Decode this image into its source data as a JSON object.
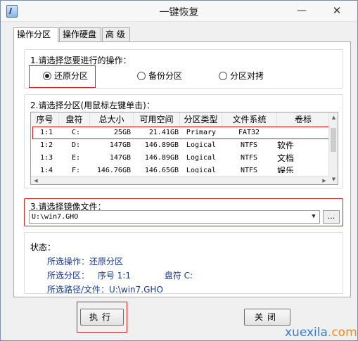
{
  "window": {
    "title": "一键恢复",
    "minimize": "—",
    "close": "✕",
    "icon": "app-icon"
  },
  "tabs": [
    {
      "label": "操作分区"
    },
    {
      "label": "操作硬盘"
    },
    {
      "label": "高 级"
    }
  ],
  "section1": {
    "title": "1.请选择您要进行的操作：",
    "options": [
      {
        "label": "还原分区",
        "selected": true
      },
      {
        "label": "备份分区",
        "selected": false
      },
      {
        "label": "分区对拷",
        "selected": false
      }
    ]
  },
  "section2": {
    "title": "2.请选择分区(用鼠标左键单击)：",
    "columns": [
      "序号",
      "盘符",
      "总大小",
      "可用空间",
      "分区类型",
      "文件系统",
      "卷标"
    ],
    "rows": [
      [
        "1:1",
        "C:",
        "25GB",
        "21.41GB",
        "Primary",
        "FAT32",
        ""
      ],
      [
        "1:2",
        "D:",
        "147GB",
        "146.89GB",
        "Logical",
        "NTFS",
        "软件"
      ],
      [
        "1:3",
        "E:",
        "147GB",
        "146.89GB",
        "Logical",
        "NTFS",
        "文档"
      ],
      [
        "1:4",
        "F:",
        "146.76GB",
        "146.65GB",
        "Logical",
        "NTFS",
        "娱乐"
      ]
    ]
  },
  "section3": {
    "title": "3.请选择镜像文件：",
    "file_value": "U:\\win7.GHO",
    "browse_label": "..."
  },
  "status": {
    "title": "状态：",
    "operation": "所选操作：还原分区",
    "partition_label": "所选分区：",
    "partition_index": "序号 1:1",
    "partition_drive": "盘符 C:",
    "path": "所选路径/文件：U:\\win7.GHO"
  },
  "buttons": {
    "execute": "执行",
    "close": "关闭"
  },
  "watermark": {
    "name": "xuexila",
    "domain": ".com"
  },
  "colors": {
    "highlight": "#d22020",
    "status_text": "#1a3a8a"
  }
}
